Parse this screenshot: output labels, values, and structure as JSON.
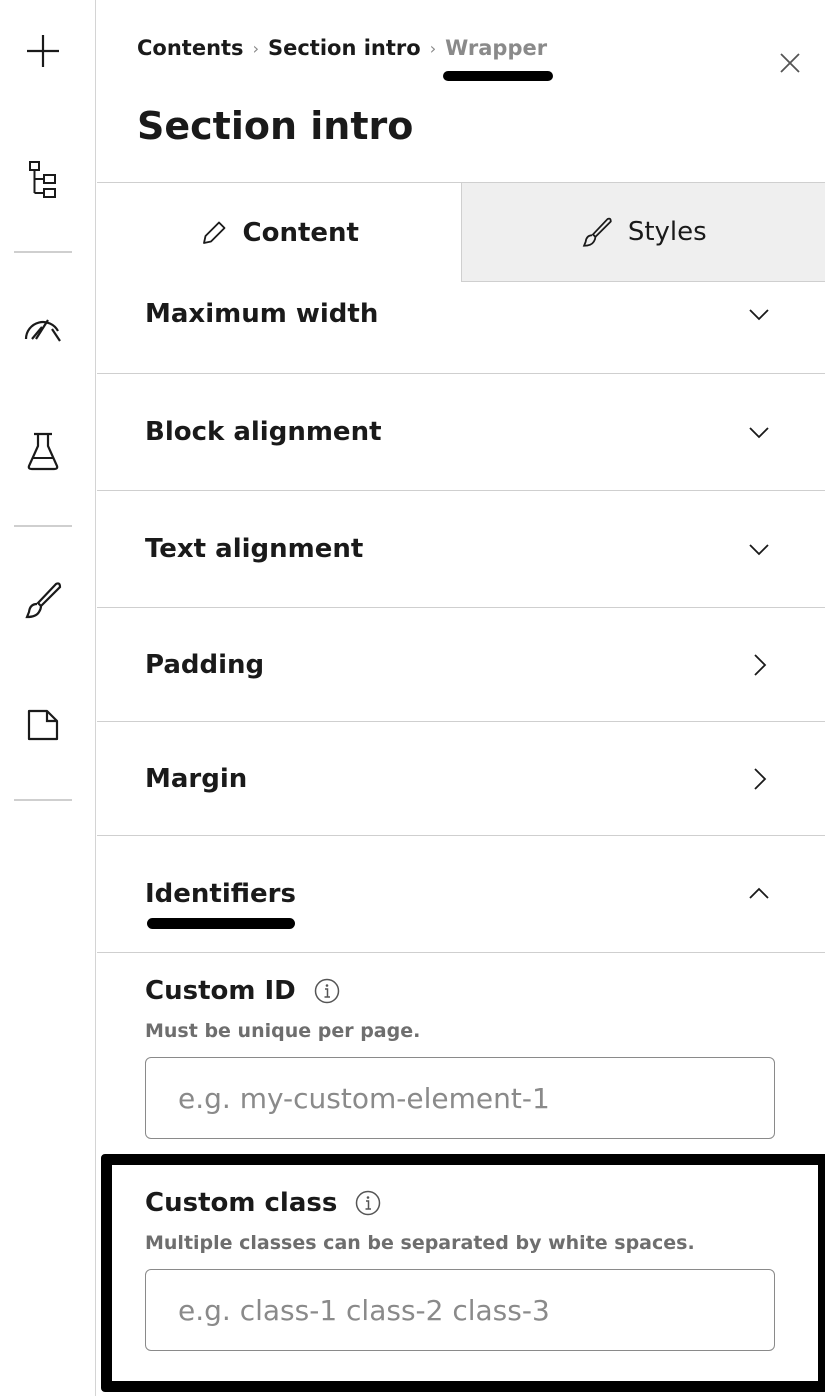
{
  "breadcrumb": {
    "items": [
      "Contents",
      "Section intro"
    ],
    "current": "Wrapper",
    "separator": "›"
  },
  "page_title": "Section intro",
  "tabs": [
    {
      "label": "Content",
      "icon": "pencil-icon",
      "active": true
    },
    {
      "label": "Styles",
      "icon": "brush-icon",
      "active": false
    }
  ],
  "sections": [
    {
      "label": "Maximum width",
      "state": "collapsed",
      "chevron": "chevron-down-icon"
    },
    {
      "label": "Block alignment",
      "state": "collapsed",
      "chevron": "chevron-down-icon"
    },
    {
      "label": "Text alignment",
      "state": "collapsed",
      "chevron": "chevron-down-icon"
    },
    {
      "label": "Padding",
      "state": "closed",
      "chevron": "chevron-right-icon"
    },
    {
      "label": "Margin",
      "state": "closed",
      "chevron": "chevron-right-icon"
    },
    {
      "label": "Identifiers",
      "state": "expanded",
      "chevron": "chevron-up-icon"
    }
  ],
  "fields": {
    "custom_id": {
      "label": "Custom ID",
      "help": "Must be unique per page.",
      "placeholder": "e.g. my-custom-element-1",
      "value": ""
    },
    "custom_class": {
      "label": "Custom class",
      "help": "Multiple classes can be separated by white spaces.",
      "placeholder": "e.g. class-1 class-2 class-3",
      "value": ""
    }
  },
  "rail_icons": [
    "plus-icon",
    "tree-structure-icon",
    "gauge-icon",
    "flask-icon",
    "brush-icon",
    "page-icon"
  ],
  "colors": {
    "text": "#1a1a1a",
    "muted": "#8a8a8a",
    "border": "#cfcfcf",
    "inactive_tab_bg": "#efefef",
    "highlight": "#000000"
  }
}
